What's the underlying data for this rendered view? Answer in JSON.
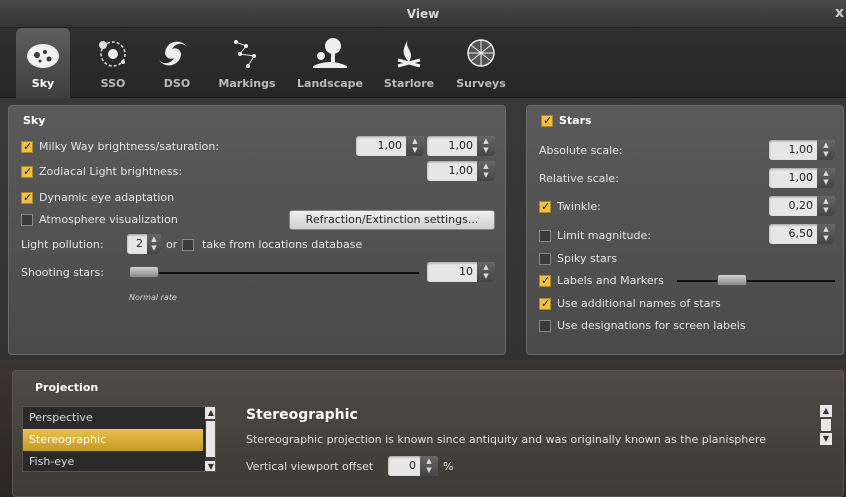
{
  "window": {
    "title": "View",
    "close": "x"
  },
  "tabs": [
    {
      "label": "Sky",
      "icon": "planet-sky-icon",
      "active": true
    },
    {
      "label": "SSO",
      "icon": "solar-system-icon",
      "active": false
    },
    {
      "label": "DSO",
      "icon": "galaxy-icon",
      "active": false
    },
    {
      "label": "Markings",
      "icon": "constellation-markings-icon",
      "active": false
    },
    {
      "label": "Landscape",
      "icon": "tree-landscape-icon",
      "active": false
    },
    {
      "label": "Starlore",
      "icon": "campfire-starlore-icon",
      "active": false
    },
    {
      "label": "Surveys",
      "icon": "globe-surveys-icon",
      "active": false
    }
  ],
  "sky": {
    "header": "Sky",
    "milky_way": {
      "label": "Milky Way brightness/saturation:",
      "checked": true,
      "value1": "1,00",
      "value2": "1,00"
    },
    "zodiacal": {
      "label": "Zodiacal Light brightness:",
      "checked": true,
      "value": "1,00"
    },
    "dynamic_eye": {
      "label": "Dynamic eye adaptation",
      "checked": true
    },
    "atmosphere": {
      "label": "Atmosphere visualization",
      "checked": false,
      "button": "Refraction/Extinction settings..."
    },
    "light_pollution": {
      "label": "Light pollution:",
      "value": "2",
      "or": "or",
      "db_label": "take from locations database",
      "db_checked": false
    },
    "shooting_stars": {
      "label": "Shooting stars:",
      "value": "10",
      "rate": "Normal rate",
      "level": 0.02
    }
  },
  "stars": {
    "header": "Stars",
    "checked": true,
    "absolute_scale": {
      "label": "Absolute scale:",
      "value": "1,00"
    },
    "relative_scale": {
      "label": "Relative scale:",
      "value": "1,00"
    },
    "twinkle": {
      "label": "Twinkle:",
      "checked": true,
      "value": "0,20"
    },
    "limit_magnitude": {
      "label": "Limit magnitude:",
      "checked": false,
      "value": "6,50"
    },
    "spiky": {
      "label": "Spiky stars",
      "checked": false
    },
    "labels_markers": {
      "label": "Labels and Markers",
      "checked": true,
      "level": 0.35
    },
    "additional_names": {
      "label": "Use additional names of stars",
      "checked": true
    },
    "designations": {
      "label": "Use designations for screen labels",
      "checked": false
    }
  },
  "projection": {
    "header": "Projection",
    "items": [
      "Perspective",
      "Stereographic",
      "Fish-eye"
    ],
    "selected": "Stereographic",
    "title": "Stereographic",
    "description": "Stereographic projection is known since antiquity and was originally known as the planisphere",
    "offset_label": "Vertical viewport offset",
    "offset_value": "0",
    "offset_unit": "%"
  },
  "colors": {
    "accent": "#f0c040",
    "selected": "#d8a830"
  }
}
